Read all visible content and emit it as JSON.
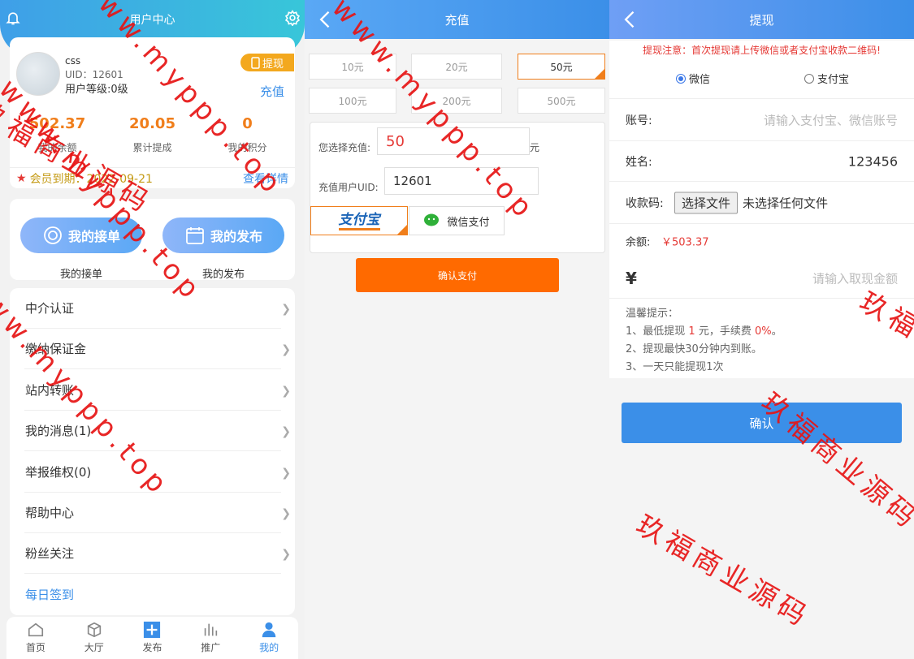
{
  "user_center": {
    "title": "用户中心",
    "user": {
      "name": "css",
      "uid": "UID：12601",
      "level": "用户等级:0级"
    },
    "withdraw_badge": "提现",
    "recharge_link": "充值",
    "stats": [
      {
        "value": "502.37",
        "label": "我的余额"
      },
      {
        "value": "20.05",
        "label": "累计提成"
      },
      {
        "value": "0",
        "label": "我的积分"
      }
    ],
    "vip": {
      "text": "会员到期：2022-09-21",
      "detail": "查看详情"
    },
    "orders": [
      {
        "button": "我的接单",
        "label": "我的接单"
      },
      {
        "button": "我的发布",
        "label": "我的发布"
      }
    ],
    "menu": [
      "中介认证",
      "缴纳保证金",
      "站内转账",
      "我的消息(1)",
      "举报维权(0)",
      "帮助中心",
      "粉丝关注",
      "每日签到"
    ],
    "tabs": [
      {
        "label": "首页",
        "icon": "home-icon"
      },
      {
        "label": "大厅",
        "icon": "cube-icon"
      },
      {
        "label": "发布",
        "icon": "plus-icon"
      },
      {
        "label": "推广",
        "icon": "bar-chart-icon"
      },
      {
        "label": "我的",
        "icon": "user-icon"
      }
    ]
  },
  "recharge": {
    "title": "充值",
    "amounts": [
      "10元",
      "20元",
      "50元",
      "100元",
      "200元",
      "500元"
    ],
    "selected_amount": "50元",
    "amount_label": "您选择充值:",
    "amount_value": "50",
    "amount_unit": "元",
    "uid_label": "充值用户UID:",
    "uid_value": "12601",
    "alipay_label": "支付宝",
    "wechat_label": "微信支付",
    "confirm": "确认支付"
  },
  "withdraw": {
    "title": "提现",
    "notice": "提现注意：首次提现请上传微信或者支付宝收款二维码!",
    "methods": [
      "微信",
      "支付宝"
    ],
    "selected_method": "微信",
    "account_label": "账号:",
    "account_placeholder": "请输入支付宝、微信账号",
    "name_label": "姓名:",
    "name_value": "123456",
    "qrcode_label": "收款码:",
    "file_button": "选择文件",
    "file_status": "未选择任何文件",
    "balance_label": "余额:",
    "balance_value": "￥503.37",
    "currency": "¥",
    "amount_placeholder": "请输入取现金额",
    "tips_title": "温馨提示：",
    "tip1_prefix": "1、最低提现",
    "tip1_min": "1",
    "tip1_mid": "元，手续费",
    "tip1_fee": "0%",
    "tip1_end": "。",
    "tip2": "2、提现最快30分钟内到账。",
    "tip3": "3、一天只能提现1次",
    "submit": "确认"
  },
  "watermark": {
    "url": "www.myppp.top",
    "cn": "玖福商业源码"
  },
  "colors": {
    "accent": "#3b8fe8",
    "orange": "#f07e1b",
    "pay_button": "#ff6a00",
    "warning": "#e53935"
  }
}
